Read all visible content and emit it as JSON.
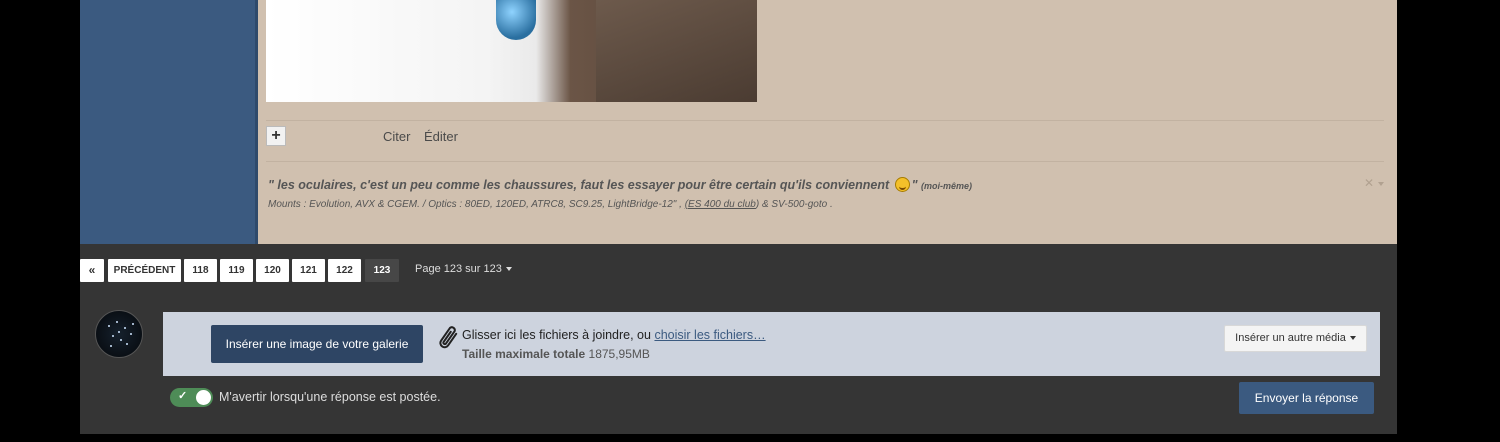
{
  "post": {
    "actions": {
      "quote": "Citer",
      "edit": "Éditer"
    },
    "signature": {
      "quote": "\" les oculaires, c'est un peu comme les chaussures, faut les essayer pour être certain qu'ils conviennent",
      "quote_end": "\"",
      "author": "(moi-même)",
      "gear_prefix": "Mounts : Evolution, AVX & CGEM. /  Optics : 80ED, 120ED, ATRC8, SC9.25, LightBridge-12\" ,",
      "gear_link": "(ES 400 du club",
      "gear_suffix": ") & SV-500-goto ."
    }
  },
  "pagination": {
    "prev": "PRÉCÉDENT",
    "pages": [
      "118",
      "119",
      "120",
      "121",
      "122",
      "123"
    ],
    "current": "123",
    "info": "Page 123 sur 123"
  },
  "upload": {
    "gallery_button": "Insérer une image de votre galerie",
    "drop_text": "Glisser ici les fichiers à joindre, ou",
    "drop_link": "choisir les fichiers…",
    "max_size_label": "Taille maximale totale",
    "max_size_value": "1875,95MB",
    "media_button": "Insérer un autre média"
  },
  "reply": {
    "notify_label": "M'avertir lorsqu'une réponse est postée.",
    "notify_enabled": true,
    "submit": "Envoyer la réponse"
  },
  "icons": [
    "double-chevron-left-icon",
    "caret-down-icon",
    "paperclip-icon",
    "check-icon",
    "close-icon",
    "plus-icon",
    "smiley-icon"
  ],
  "colors": {
    "accent": "#3b5a80",
    "toggle_on": "#4e8c57"
  }
}
